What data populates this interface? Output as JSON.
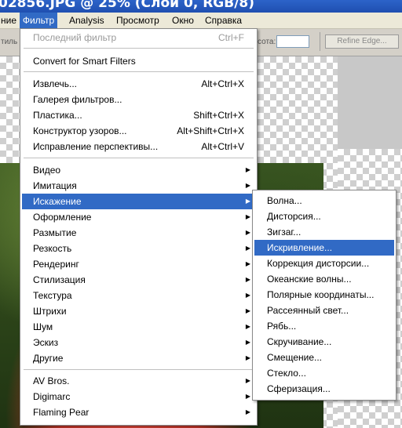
{
  "window": {
    "title": "02856.JPG @ 25% (Слой 0, RGB/8)"
  },
  "menubar": {
    "items": [
      "ние",
      "Фильтр",
      "Analysis",
      "Просмотр",
      "Окно",
      "Справка"
    ],
    "active_index": 1
  },
  "options_bar": {
    "left_label": "тиль",
    "field_label": "сота:",
    "refine_button": "Refine Edge..."
  },
  "filter_menu": {
    "last_filter": {
      "label": "Последний фильтр",
      "shortcut": "Ctrl+F"
    },
    "smart_filters": "Convert for Smart Filters",
    "tools": [
      {
        "label": "Извлечь...",
        "shortcut": "Alt+Ctrl+X"
      },
      {
        "label": "Галерея фильтров...",
        "shortcut": ""
      },
      {
        "label": "Пластика...",
        "shortcut": "Shift+Ctrl+X"
      },
      {
        "label": "Конструктор узоров...",
        "shortcut": "Alt+Shift+Ctrl+X"
      },
      {
        "label": "Исправление перспективы...",
        "shortcut": "Alt+Ctrl+V"
      }
    ],
    "categories": [
      "Видео",
      "Имитация",
      "Искажение",
      "Оформление",
      "Размытие",
      "Резкость",
      "Рендеринг",
      "Стилизация",
      "Текстура",
      "Штрихи",
      "Шум",
      "Эскиз",
      "Другие"
    ],
    "highlighted_category": "Искажение",
    "plugins": [
      "AV Bros.",
      "Digimarc",
      "Flaming Pear"
    ]
  },
  "distort_submenu": {
    "items": [
      "Волна...",
      "Дисторсия...",
      "Зигзаг...",
      "Искривление...",
      "Коррекция дисторсии...",
      "Океанские волны...",
      "Полярные координаты...",
      "Рассеянный свет...",
      "Рябь...",
      "Скручивание...",
      "Смещение...",
      "Стекло...",
      "Сферизация..."
    ],
    "highlighted": "Искривление..."
  },
  "colors": {
    "highlight": "#316ac5",
    "menu_bg": "#ffffff",
    "disabled": "#9a9a9a"
  },
  "icons": {
    "submenu_arrow": "triangle-right-icon"
  }
}
